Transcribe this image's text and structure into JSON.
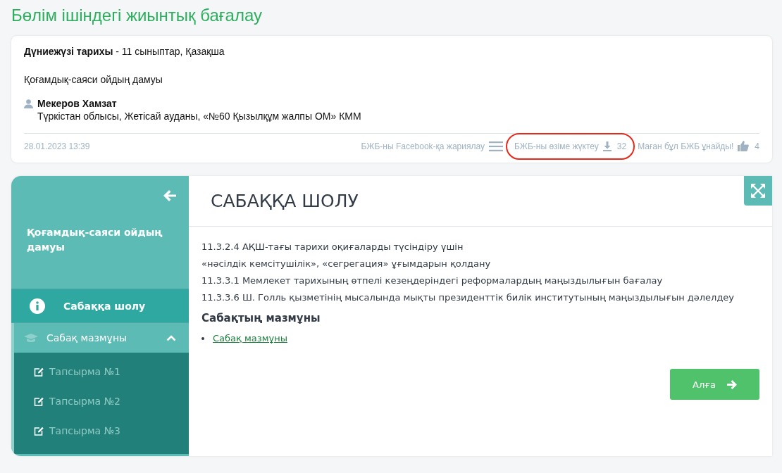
{
  "page_title": "Бөлім ішіндегі жиынтық бағалау",
  "card": {
    "heading": "**Дүниежүзі тарихы** - 11 сыныптар, Қазақша",
    "topic": "Қоғамдық-саяси ойдың дамуы",
    "author": {
      "name": "Мекеров Хамзат",
      "school": "Түркістан облысы, Жетісай ауданы, «№60 Қызылқұм жалпы ОМ» КММ"
    },
    "date": "28.01.2023 13:39",
    "actions": [
      {
        "kind": "share",
        "label": "БЖБ-ны Facebook-қа жариялау",
        "highlighted": false
      },
      {
        "kind": "download",
        "label": "БЖБ-ны өзіме жүктеу",
        "count": "32",
        "highlighted": true
      },
      {
        "kind": "like",
        "label": "Маған бұл БЖБ ұнайды!",
        "count": "4",
        "highlighted": false
      }
    ]
  },
  "sidebar": {
    "title": "Қоғамдық-саяси ойдың дамуы",
    "items": [
      {
        "kind": "overview",
        "label": "Сабаққа шолу",
        "selected": true
      },
      {
        "kind": "section",
        "label": "Сабақ мазмұны",
        "selected": false,
        "expanded": true,
        "children": [
          {
            "label": "Тапсырма №1",
            "selected": false
          },
          {
            "label": "Тапсырма №2",
            "selected": false
          },
          {
            "label": "Тапсырма №3",
            "selected": false
          }
        ]
      }
    ]
  },
  "content": {
    "heading": "САБАҚҚА ШОЛУ",
    "objectives": [
      "11.3.2.4 АҚШ-тағы тарихи оқиғаларды түсіндіру үшін",
      "«нәсілдік кемсітушілік», «сегрегация» ұғымдарын қолдану",
      "11.3.3.1 Мемлекет тарихының өтпелі кезеңдеріндегі реформалардың маңыздылығын бағалау",
      "11.3.3.6 Ш. Голль қызметінің мысалында мықты президенттік билік институтының маңыздылығын дәлелдеу"
    ],
    "subheading": "Сабақтың мазмұны",
    "links": [
      "Сабақ мазмұны"
    ],
    "next_button": "Алға"
  }
}
